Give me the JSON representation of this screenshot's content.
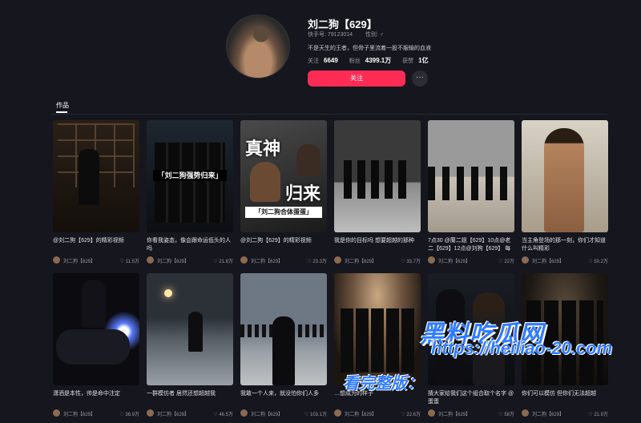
{
  "profile": {
    "name": "刘二狗【629】",
    "id_label": "快手号: 79123014",
    "gender_label": "性别: ♂",
    "bio": "不是天生的王者，但骨子里流着一股不服输的血液",
    "stats": [
      {
        "label": "关注",
        "value": "6649"
      },
      {
        "label": "粉丝",
        "value": "4399.1万"
      },
      {
        "label": "获赞",
        "value": "1亿"
      }
    ],
    "follow_label": "关注",
    "more_label": "···"
  },
  "tabs": {
    "works": "作品"
  },
  "author": "刘二狗【629】",
  "videos": [
    {
      "caption": "@刘二狗【629】的精彩视频",
      "likes": "11.5万"
    },
    {
      "caption": "你看我姿态，像会跟命运低头的人吗",
      "likes": "21.8万"
    },
    {
      "caption": "@刘二狗【629】的精彩视频",
      "likes": "23.3万",
      "overlay": [
        "真神",
        "归来"
      ],
      "tag1": "「刘二狗强势归来」",
      "tag2": "「刘二狗合体蛋蛋」"
    },
    {
      "caption": "我是你的目标吗 想要超越的那种",
      "likes": "33.7万"
    },
    {
      "caption": "7点30 @蘭二姐【629】10点@老二【629】12点@刘狗【629】 每晚…",
      "likes": "22万"
    },
    {
      "caption": "当主角登场的那一刻，你们才知道什么叫精彩",
      "likes": "50.2万"
    },
    {
      "caption": "潇洒是本性，帅是命中注定",
      "likes": "36.9万"
    },
    {
      "caption": "一群模仿者 居然还想超越我",
      "likes": "46.5万"
    },
    {
      "caption": "我敢一个人来，就没怕你们人多",
      "likes": "103.1万"
    },
    {
      "caption": "…想成为的样子",
      "likes": "22.6万"
    },
    {
      "caption": "猜大家给我们这个组合取个名字 @蛋蛋",
      "likes": "58万"
    },
    {
      "caption": "你们可以模仿 但你们无法超越",
      "likes": "21.9万"
    }
  ],
  "watermark": {
    "site": "黑料吃瓜网",
    "cta": "看完整版：",
    "url": "https://heiliao-20.com"
  }
}
